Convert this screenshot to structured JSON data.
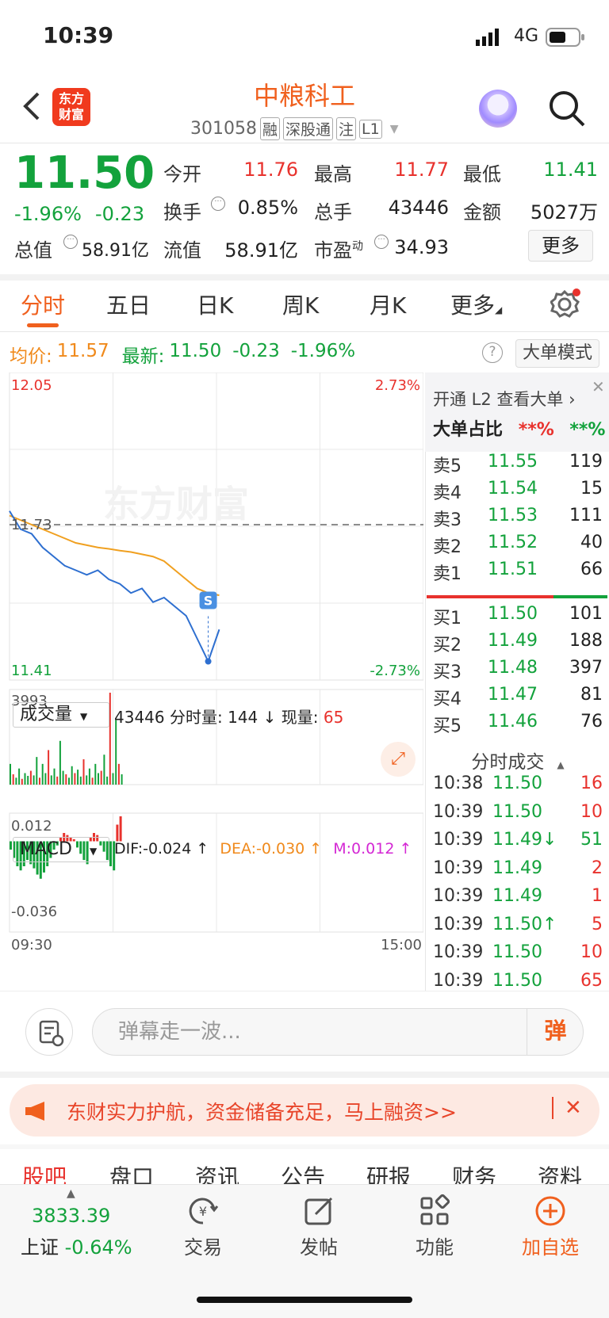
{
  "status": {
    "time": "10:39",
    "network": "4G"
  },
  "header": {
    "logo": [
      "东方",
      "财富"
    ],
    "name": "中粮科工",
    "code": "301058",
    "tags": [
      "融",
      "深股通",
      "注",
      "L1"
    ]
  },
  "quote": {
    "price": "11.50",
    "change_pct": "-1.96%",
    "change_val": "-0.23",
    "fields": [
      {
        "label": "今开",
        "value": "11.76",
        "color": "red"
      },
      {
        "label": "最高",
        "value": "11.77",
        "color": "red"
      },
      {
        "label": "最低",
        "value": "11.41",
        "color": "green"
      },
      {
        "label": "换手",
        "value": "0.85%",
        "color": "black"
      },
      {
        "label": "总手",
        "value": "43446",
        "color": "black"
      },
      {
        "label": "金额",
        "value": "5027万",
        "color": "black"
      },
      {
        "label": "总值",
        "value": "58.91亿",
        "color": "black"
      },
      {
        "label": "流值",
        "value": "58.91亿",
        "color": "black"
      },
      {
        "label": "市盈",
        "superscript": "动",
        "value": "34.93",
        "color": "black"
      }
    ],
    "more_label": "更多"
  },
  "tabs": [
    "分时",
    "五日",
    "日K",
    "周K",
    "月K",
    "更多"
  ],
  "legend": {
    "avg_label": "均价:",
    "avg_value": "11.57",
    "last_label": "最新:",
    "last_value": "11.50",
    "last_change": "-0.23",
    "last_pct": "-1.96%",
    "help": "?",
    "bigorder_mode": "大单模式"
  },
  "chart_data": [
    {
      "type": "line",
      "watermark": "东方财富",
      "ylim": [
        11.41,
        12.05
      ],
      "y_labels_left": [
        "12.05",
        "11.73",
        "11.41"
      ],
      "y_labels_right": [
        "2.73%",
        "-2.73%"
      ],
      "x_labels": [
        "09:30",
        "15:00"
      ],
      "prev_close": 11.73,
      "marker": "S",
      "series": [
        {
          "name": "均价",
          "values": [
            11.75,
            11.74,
            11.73,
            11.72,
            11.71,
            11.7,
            11.69,
            11.685,
            11.68,
            11.677,
            11.673,
            11.67,
            11.665,
            11.66,
            11.65,
            11.63,
            11.61,
            11.59,
            11.58,
            11.575
          ]
        },
        {
          "name": "最新",
          "values": [
            11.76,
            11.72,
            11.71,
            11.68,
            11.66,
            11.64,
            11.63,
            11.62,
            11.63,
            11.61,
            11.6,
            11.58,
            11.59,
            11.56,
            11.57,
            11.55,
            11.53,
            11.48,
            11.43,
            11.5
          ]
        }
      ]
    },
    {
      "type": "bar",
      "name": "成交量",
      "ylim": [
        0,
        3993
      ],
      "y_labels": [
        "3993"
      ],
      "values": [
        900,
        450,
        300,
        700,
        250,
        500,
        380,
        600,
        400,
        1200,
        300,
        900,
        500,
        1500,
        400,
        700,
        350,
        1900,
        600,
        450,
        300,
        800,
        500,
        650,
        350,
        1100,
        400,
        700,
        300,
        900,
        500,
        600,
        1300,
        350,
        3993,
        500,
        2800,
        900,
        450
      ]
    },
    {
      "type": "bar",
      "name": "MACD",
      "ylim": [
        -0.036,
        0.012
      ],
      "y_labels": [
        "0.012",
        "-0.036"
      ],
      "values": [
        -0.004,
        -0.008,
        -0.012,
        -0.014,
        -0.012,
        -0.009,
        -0.011,
        -0.013,
        -0.016,
        -0.018,
        -0.015,
        -0.012,
        -0.008,
        -0.004,
        -0.002,
        0.002,
        0.004,
        0.003,
        0.002,
        0.001,
        -0.003,
        -0.006,
        -0.009,
        -0.011,
        0.002,
        0.004,
        0.003,
        -0.002,
        -0.005,
        -0.009,
        -0.012,
        -0.014,
        0.008,
        0.012
      ]
    }
  ],
  "volume_row": {
    "select": "成交量",
    "total": "43446",
    "label1": "分时量:",
    "v1": "144",
    "arrow": "↓",
    "label2": "现量:",
    "v2": "65"
  },
  "macd_row": {
    "select": "MACD",
    "dif": "DIF:-0.024 ↑",
    "dea": "DEA:-0.030 ↑",
    "m": "M:0.012 ↑"
  },
  "orderbook": {
    "l2_text": "开通 L2 查看大单 ›",
    "big_ratio_label": "大单占比",
    "big_ratio_red": "**%",
    "big_ratio_green": "**%",
    "asks": [
      {
        "label": "卖5",
        "price": "11.55",
        "vol": "119"
      },
      {
        "label": "卖4",
        "price": "11.54",
        "vol": "15"
      },
      {
        "label": "卖3",
        "price": "11.53",
        "vol": "111"
      },
      {
        "label": "卖2",
        "price": "11.52",
        "vol": "40"
      },
      {
        "label": "卖1",
        "price": "11.51",
        "vol": "66"
      }
    ],
    "bids": [
      {
        "label": "买1",
        "price": "11.50",
        "vol": "101"
      },
      {
        "label": "买2",
        "price": "11.49",
        "vol": "188"
      },
      {
        "label": "买3",
        "price": "11.48",
        "vol": "397"
      },
      {
        "label": "买4",
        "price": "11.47",
        "vol": "81"
      },
      {
        "label": "买5",
        "price": "11.46",
        "vol": "76"
      }
    ],
    "ticks_title": "分时成交",
    "ticks": [
      {
        "time": "10:38",
        "price": "11.50",
        "vol": "16",
        "vcolor": "red"
      },
      {
        "time": "10:39",
        "price": "11.50",
        "vol": "10",
        "vcolor": "red"
      },
      {
        "time": "10:39",
        "price": "11.49↓",
        "vol": "51",
        "vcolor": "green"
      },
      {
        "time": "10:39",
        "price": "11.49",
        "vol": "2",
        "vcolor": "red"
      },
      {
        "time": "10:39",
        "price": "11.49",
        "vol": "1",
        "vcolor": "red"
      },
      {
        "time": "10:39",
        "price": "11.50↑",
        "vol": "5",
        "vcolor": "red"
      },
      {
        "time": "10:39",
        "price": "11.50",
        "vol": "10",
        "vcolor": "red"
      },
      {
        "time": "10:39",
        "price": "11.50",
        "vol": "65",
        "vcolor": "red"
      }
    ]
  },
  "comment": {
    "placeholder": "弹幕走一波...",
    "send": "弹"
  },
  "promo": {
    "text": "东财实力护航，资金储备充足，马上融资>>",
    "close": "✕"
  },
  "sub_tabs": [
    "股吧",
    "盘口",
    "资讯",
    "公告",
    "研报",
    "财务",
    "资料"
  ],
  "bottom_nav": {
    "index_value": "3833.39",
    "index_name": "上证",
    "index_change": "-0.64%",
    "items": [
      "交易",
      "发帖",
      "功能",
      "加自选"
    ]
  }
}
